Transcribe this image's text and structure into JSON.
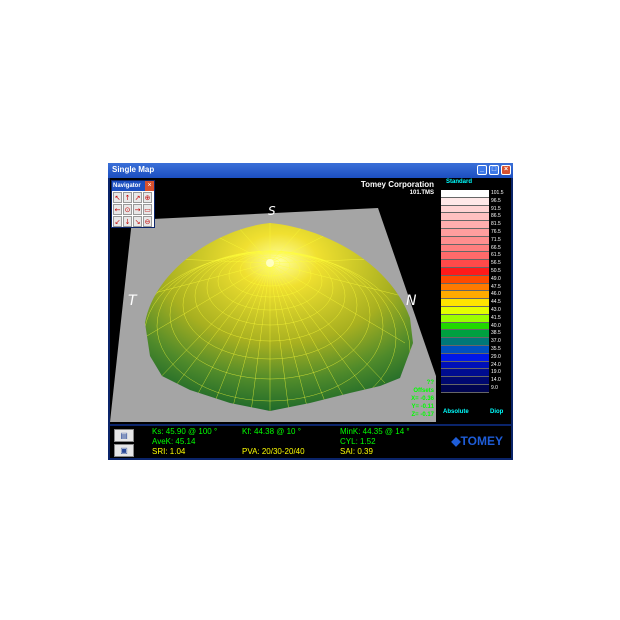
{
  "window": {
    "title": "Single Map"
  },
  "map": {
    "company": "Tomey Corporation",
    "filename": "101.TMS",
    "directions": {
      "top": "S",
      "left": "T",
      "right": "N"
    },
    "offsets": {
      "label": "Offsets",
      "code": "??",
      "x": "X=  -0.36",
      "y": "Y=  -0.11",
      "z": "Z=  -0.17"
    }
  },
  "navigator": {
    "title": "Navigator",
    "buttons": [
      "↖",
      "↑",
      "↗",
      "⊕",
      "←",
      "⊙",
      "→",
      "▭",
      "↙",
      "↓",
      "↘",
      "⊖"
    ]
  },
  "scale": {
    "header": "Standard",
    "footer_left": "Absolute",
    "footer_right": "Diop",
    "entries": [
      {
        "value": "101.5",
        "color": "#ffffff"
      },
      {
        "value": "96.5",
        "color": "#ffe8e8"
      },
      {
        "value": "91.5",
        "color": "#ffd3d3"
      },
      {
        "value": "86.5",
        "color": "#ffc0c0"
      },
      {
        "value": "81.5",
        "color": "#ffaeae"
      },
      {
        "value": "76.5",
        "color": "#ff9e9e"
      },
      {
        "value": "71.5",
        "color": "#ff8e8e"
      },
      {
        "value": "66.5",
        "color": "#ff7e7e"
      },
      {
        "value": "61.5",
        "color": "#ff6a6a"
      },
      {
        "value": "56.5",
        "color": "#ff4a4a"
      },
      {
        "value": "50.5",
        "color": "#ff1a1a"
      },
      {
        "value": "49.0",
        "color": "#ff4a00"
      },
      {
        "value": "47.5",
        "color": "#ff7a00"
      },
      {
        "value": "46.0",
        "color": "#ffaa00"
      },
      {
        "value": "44.5",
        "color": "#ffe400"
      },
      {
        "value": "43.0",
        "color": "#e4ff00"
      },
      {
        "value": "41.5",
        "color": "#9cff00"
      },
      {
        "value": "40.0",
        "color": "#22d800"
      },
      {
        "value": "38.5",
        "color": "#00a040"
      },
      {
        "value": "37.0",
        "color": "#007878"
      },
      {
        "value": "35.5",
        "color": "#0050c0"
      },
      {
        "value": "29.0",
        "color": "#0018e8"
      },
      {
        "value": "24.0",
        "color": "#0010b8"
      },
      {
        "value": "19.0",
        "color": "#000c90"
      },
      {
        "value": "14.0",
        "color": "#000870"
      },
      {
        "value": "9.0",
        "color": "#000450"
      }
    ]
  },
  "stats": {
    "ks": "Ks: 45.90 @ 100 °",
    "kf": "Kf: 44.38 @  10 °",
    "mink": "MinK: 44.35 @  14 °",
    "avek": "AveK: 45.14",
    "cyl": "CYL:   1.52",
    "sri": "SRI: 1.04",
    "pva": "PVA: 20/30-20/40",
    "sai": "SAI: 0.39"
  },
  "brand": {
    "logo_text": "TOMEY"
  }
}
